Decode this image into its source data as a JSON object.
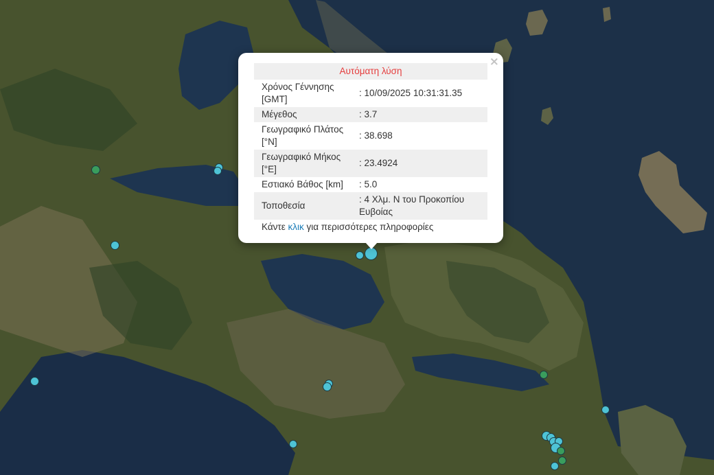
{
  "popup": {
    "title": "Αυτόματη λύση",
    "close_label": "×",
    "rows": [
      {
        "label": "Χρόνος Γέννησης [GMT]",
        "value": ": 10/09/2025 10:31:31.35"
      },
      {
        "label": "Μέγεθος",
        "value": ": 3.7"
      },
      {
        "label": "Γεωγραφικό Πλάτος [°N]",
        "value": ": 38.698"
      },
      {
        "label": "Γεωγραφικό Μήκος [°E]",
        "value": ": 23.4924"
      },
      {
        "label": "Εστιακό Βάθος [km]",
        "value": ": 5.0"
      },
      {
        "label": "Τοποθεσία",
        "value": ": 4 Χλμ. Ν του Προκοπίου Ευβοίας"
      }
    ],
    "footer_prefix": "Κάντε ",
    "footer_link": "κλικ",
    "footer_suffix": " για περισσότερες πληροφορίες"
  },
  "colors": {
    "sea": "#1c3048",
    "land_dark": "#3c4a2c",
    "land_light": "#76705a",
    "marker_cyan": "#4ec3d6",
    "marker_green": "#3a9d5d",
    "title_red": "#e53c3c",
    "link_blue": "#1c7db8"
  }
}
